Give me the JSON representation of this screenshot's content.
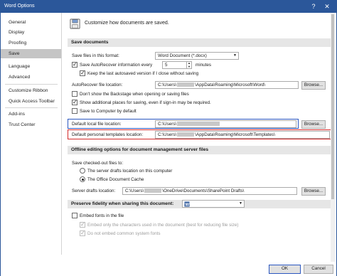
{
  "window": {
    "title": "Word Options",
    "help_glyph": "?",
    "close_glyph": "✕"
  },
  "sidebar": {
    "items": [
      {
        "label": "General"
      },
      {
        "label": "Display"
      },
      {
        "label": "Proofing"
      },
      {
        "label": "Save",
        "active": true
      },
      {
        "label": "Language"
      },
      {
        "label": "Advanced"
      },
      {
        "label": "Customize Ribbon"
      },
      {
        "label": "Quick Access Toolbar"
      },
      {
        "label": "Add-ins"
      },
      {
        "label": "Trust Center"
      }
    ]
  },
  "main": {
    "header": "Customize how documents are saved.",
    "save_documents": {
      "title": "Save documents",
      "format_label": "Save files in this format:",
      "format_value": "Word Document (*.docx)",
      "autorecover_label": "Save AutoRecover information every",
      "autorecover_checked": true,
      "autorecover_minutes": "5",
      "minutes_label": "minutes",
      "keep_last_label": "Keep the last autosaved version if I close without saving",
      "keep_last_checked": true,
      "autorecover_location_label": "AutoRecover file location:",
      "autorecover_location_prefix": "C:\\Users\\",
      "autorecover_location_suffix": "\\AppData\\Roaming\\Microsoft\\Word\\",
      "browse_label": "Browse...",
      "backstage_label": "Don't show the Backstage when opening or saving files",
      "backstage_checked": false,
      "additional_places_label": "Show additional places for saving, even if sign-in may be required.",
      "additional_places_checked": true,
      "save_computer_label": "Save to Computer by default",
      "save_computer_checked": false,
      "local_location_label": "Default local file location:",
      "local_location_value": "C:\\Users\\",
      "templates_label": "Default personal templates location:",
      "templates_prefix": "C:\\Users\\",
      "templates_suffix": "\\AppData\\Roaming\\Microsoft\\Templates\\"
    },
    "offline": {
      "title": "Offline editing options for document management server files",
      "checked_out_label": "Save checked-out files to:",
      "option_server": "The server drafts location on this computer",
      "option_cache": "The Office Document Cache",
      "selected": "cache",
      "drafts_label": "Server drafts location:",
      "drafts_prefix": "C:\\Users\\",
      "drafts_suffix": "\\OneDrive\\Documents\\SharePoint Drafts\\",
      "browse_label": "Browse..."
    },
    "fidelity": {
      "title": "Preserve fidelity when sharing this document:",
      "embed_fonts_label": "Embed fonts in the file",
      "embed_fonts_checked": false,
      "embed_only_label": "Embed only the characters used in the document (best for reducing file size)",
      "embed_only_checked": true,
      "no_common_label": "Do not embed common system fonts",
      "no_common_checked": true
    }
  },
  "footer": {
    "ok_label": "OK",
    "cancel_label": "Cancel"
  },
  "colors": {
    "titlebar": "#2b579a",
    "highlight_blue": "#2b57c0",
    "highlight_red": "#d42a2a"
  }
}
